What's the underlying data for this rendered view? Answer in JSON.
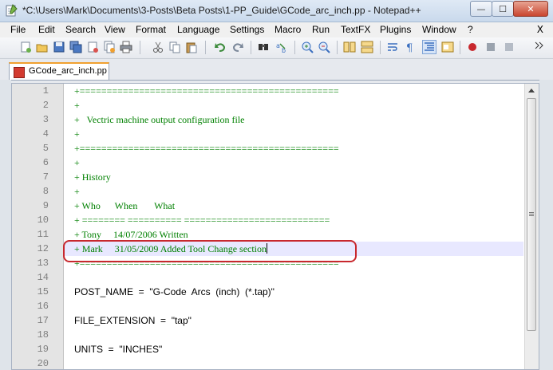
{
  "window": {
    "title": "*C:\\Users\\Mark\\Documents\\3-Posts\\Beta Posts\\1-PP_Guide\\GCode_arc_inch.pp - Notepad++",
    "minimize": "—",
    "maximize": "☐",
    "close": "✕"
  },
  "menu": {
    "items": [
      "File",
      "Edit",
      "Search",
      "View",
      "Format",
      "Language",
      "Settings",
      "Macro",
      "Run",
      "TextFX",
      "Plugins",
      "Window",
      "?"
    ],
    "close_doc": "X"
  },
  "tab": {
    "label": "GCode_arc_inch.pp"
  },
  "editor": {
    "lines": [
      {
        "n": "1",
        "text": "+================================================",
        "kind": "comment"
      },
      {
        "n": "2",
        "text": "+",
        "kind": "comment"
      },
      {
        "n": "3",
        "text": "+   Vectric machine output configuration file",
        "kind": "comment"
      },
      {
        "n": "4",
        "text": "+",
        "kind": "comment"
      },
      {
        "n": "5",
        "text": "+================================================",
        "kind": "comment"
      },
      {
        "n": "6",
        "text": "+",
        "kind": "comment"
      },
      {
        "n": "7",
        "text": "+ History",
        "kind": "comment"
      },
      {
        "n": "8",
        "text": "+",
        "kind": "comment"
      },
      {
        "n": "9",
        "text": "+ Who      When       What",
        "kind": "comment"
      },
      {
        "n": "10",
        "text": "+ ======== ========== ===========================",
        "kind": "comment"
      },
      {
        "n": "11",
        "text": "+ Tony     14/07/2006 Written",
        "kind": "comment"
      },
      {
        "n": "12",
        "text": "+ Mark     31/05/2009 Added Tool Change section",
        "kind": "comment"
      },
      {
        "n": "13",
        "text": "+================================================",
        "kind": "comment"
      },
      {
        "n": "14",
        "text": "",
        "kind": "code"
      },
      {
        "n": "15",
        "text": "POST_NAME  =  \"G-Code  Arcs  (inch)  (*.tap)\"",
        "kind": "code"
      },
      {
        "n": "16",
        "text": "",
        "kind": "code"
      },
      {
        "n": "17",
        "text": "FILE_EXTENSION  =  \"tap\"",
        "kind": "code"
      },
      {
        "n": "18",
        "text": "",
        "kind": "code"
      },
      {
        "n": "19",
        "text": "UNITS  =  \"INCHES\"",
        "kind": "code"
      },
      {
        "n": "20",
        "text": "",
        "kind": "code"
      }
    ],
    "current_line": 12
  },
  "colors": {
    "comment": "#008000",
    "highlight_ring": "#c8282e",
    "current_line_bg": "#e8e8ff"
  }
}
